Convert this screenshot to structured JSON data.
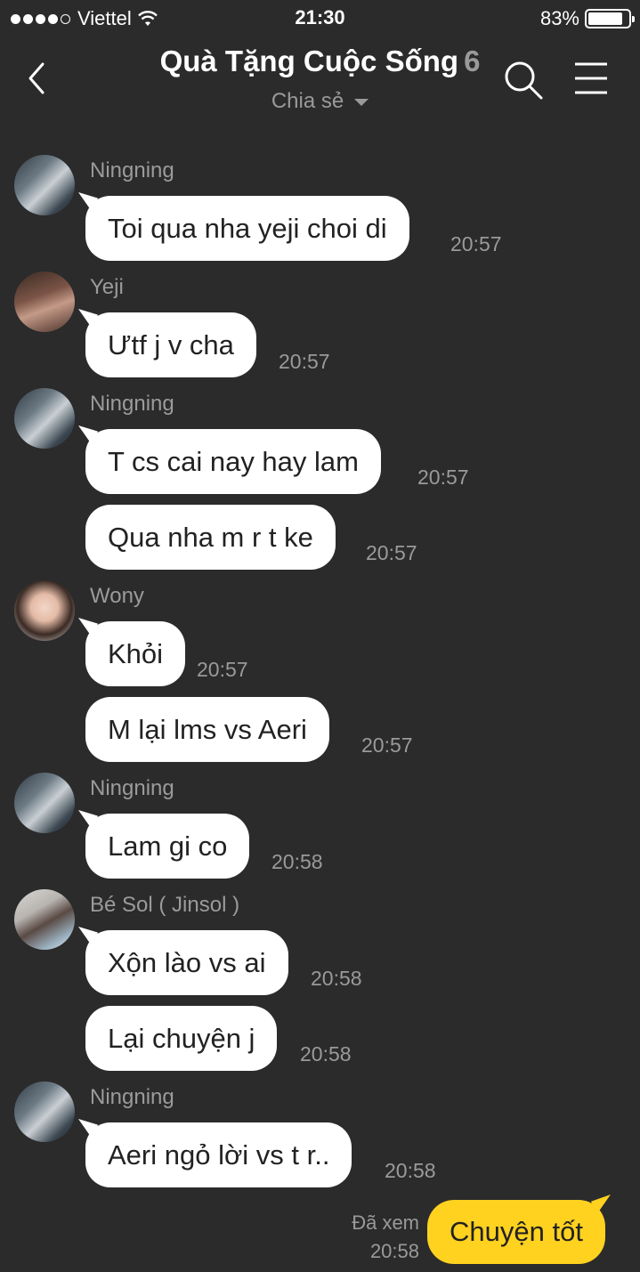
{
  "status_bar": {
    "carrier": "Viettel",
    "time": "21:30",
    "battery": "83%"
  },
  "header": {
    "title": "Quà Tặng Cuộc Sống",
    "member_count": "6",
    "subtitle": "Chia sẻ"
  },
  "messages": [
    {
      "sender": "Ningning",
      "text": "Toi qua nha yeji choi di",
      "time": "20:57"
    },
    {
      "sender": "Yeji",
      "text": "Ưtf j v cha",
      "time": "20:57"
    },
    {
      "sender": "Ningning",
      "text": "T cs cai nay hay lam",
      "time": "20:57"
    },
    {
      "sender": "",
      "text": "Qua nha m r t ke",
      "time": "20:57"
    },
    {
      "sender": "Wony",
      "text": "Khỏi",
      "time": "20:57"
    },
    {
      "sender": "",
      "text": "M lại lms vs Aeri",
      "time": "20:57"
    },
    {
      "sender": "Ningning",
      "text": "Lam gi co",
      "time": "20:58"
    },
    {
      "sender": "Bé Sol ( Jinsol )",
      "text": "Xộn lào vs ai",
      "time": "20:58"
    },
    {
      "sender": "",
      "text": "Lại chuyện j",
      "time": "20:58"
    },
    {
      "sender": "Ningning",
      "text": "Aeri ngỏ lời vs t r..",
      "time": "20:58"
    }
  ],
  "own_message": {
    "text": "Chuyện tốt",
    "seen_label": "Đã xem",
    "time": "20:58"
  },
  "colors": {
    "background": "#2b2b2b",
    "incoming_bubble": "#ffffff",
    "outgoing_bubble": "#ffd21f",
    "meta_text": "#9a9a9a"
  }
}
